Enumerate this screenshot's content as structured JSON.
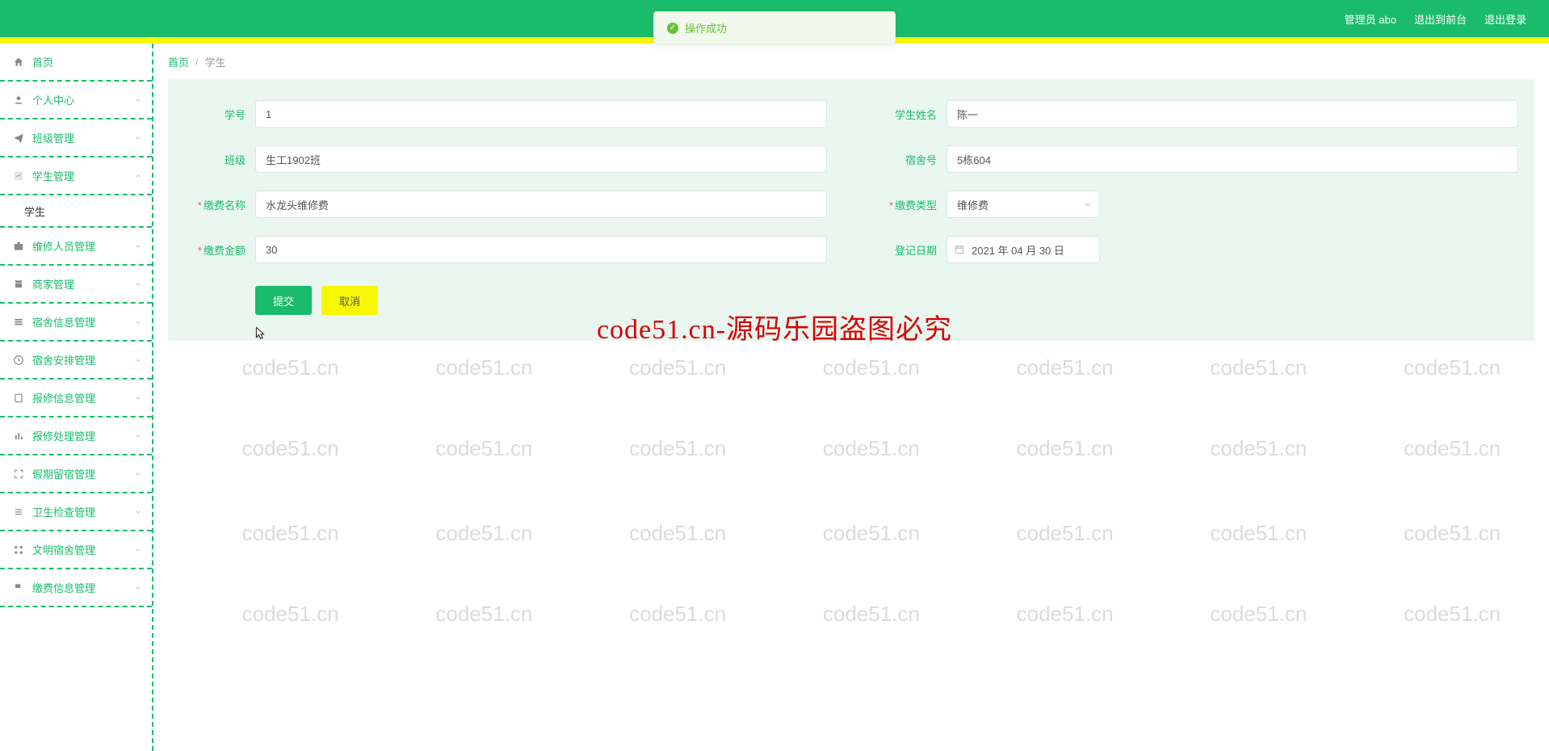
{
  "header": {
    "admin_label": "管理员 abo",
    "front_label": "退出到前台",
    "logout_label": "退出登录"
  },
  "toast": {
    "text": "操作成功"
  },
  "sidebar": {
    "items": [
      {
        "label": "首页",
        "icon": "home-icon"
      },
      {
        "label": "个人中心",
        "icon": "user-icon",
        "expandable": true
      },
      {
        "label": "班级管理",
        "icon": "send-icon",
        "expandable": true
      },
      {
        "label": "学生管理",
        "icon": "chart-icon",
        "expandable": true
      },
      {
        "label": "维修人员管理",
        "icon": "briefcase-icon",
        "expandable": true
      },
      {
        "label": "商家管理",
        "icon": "shop-icon",
        "expandable": true
      },
      {
        "label": "宿舍信息管理",
        "icon": "stack-icon",
        "expandable": true
      },
      {
        "label": "宿舍安排管理",
        "icon": "clock-icon",
        "expandable": true
      },
      {
        "label": "报修信息管理",
        "icon": "doc-icon",
        "expandable": true
      },
      {
        "label": "报修处理管理",
        "icon": "bars-icon",
        "expandable": true
      },
      {
        "label": "假期留宿管理",
        "icon": "expand-icon",
        "expandable": true
      },
      {
        "label": "卫生检查管理",
        "icon": "list-icon",
        "expandable": true
      },
      {
        "label": "文明宿舍管理",
        "icon": "grid-icon",
        "expandable": true
      },
      {
        "label": "缴费信息管理",
        "icon": "flag-icon",
        "expandable": true
      }
    ],
    "sub_student": "学生"
  },
  "crumbs": {
    "root": "首页",
    "sep": "/",
    "leaf": "学生"
  },
  "form": {
    "student_id": {
      "label": "学号",
      "value": "1"
    },
    "student_name": {
      "label": "学生姓名",
      "value": "陈一"
    },
    "class": {
      "label": "班级",
      "value": "生工1902班"
    },
    "dorm": {
      "label": "宿舍号",
      "value": "5栋604"
    },
    "fee_name": {
      "label": "缴费名称",
      "value": "水龙头维修费",
      "required": true
    },
    "fee_type": {
      "label": "缴费类型",
      "value": "维修费",
      "required": true
    },
    "fee_amount": {
      "label": "缴费金额",
      "value": "30",
      "required": true
    },
    "reg_date": {
      "label": "登记日期",
      "value": "2021 年 04 月 30 日"
    }
  },
  "buttons": {
    "submit": "提交",
    "cancel": "取消"
  },
  "watermark": {
    "text": "code51.cn",
    "big": "code51.cn-源码乐园盗图必究"
  }
}
